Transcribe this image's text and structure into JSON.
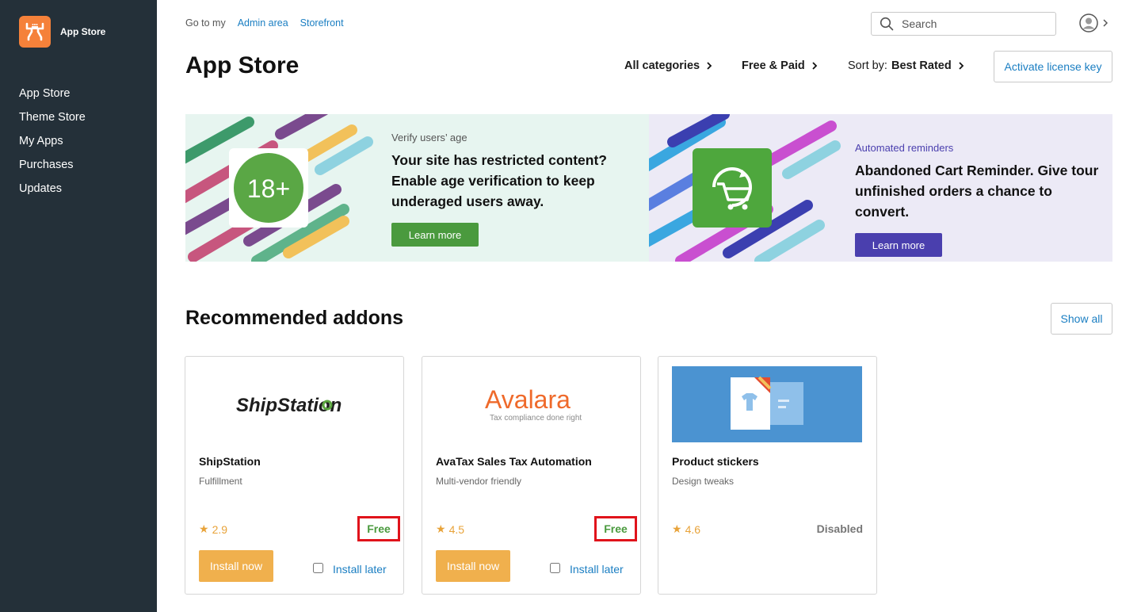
{
  "app": {
    "brand_name": "App Store"
  },
  "sidebar": {
    "items": [
      {
        "label": "App Store"
      },
      {
        "label": "Theme Store"
      },
      {
        "label": "My Apps"
      },
      {
        "label": "Purchases"
      },
      {
        "label": "Updates"
      }
    ]
  },
  "topbar": {
    "goto_text": "Go to my",
    "links": [
      "Admin area",
      "Storefront"
    ],
    "search_placeholder": "Search"
  },
  "header": {
    "title": "App Store",
    "categories_filter": "All categories",
    "price_filter": "Free & Paid",
    "sort_label": "Sort by:",
    "sort_value": "Best Rated",
    "activate_label": "Activate license key"
  },
  "banners": [
    {
      "eyebrow": "Verify users’ age",
      "headline": "Your site has restricted content? Enable age verification to keep underaged users away.",
      "badge_text": "18+",
      "button": "Learn more",
      "accent": "#4a9a3e"
    },
    {
      "eyebrow": "Automated reminders",
      "headline": "Abandoned Cart Reminder. Give tour unfinished orders a chance to convert.",
      "button": "Learn more",
      "accent": "#4a3fae"
    }
  ],
  "recommended": {
    "title": "Recommended addons",
    "show_all": "Show all",
    "cards": [
      {
        "logo_text": "ShipStation",
        "name": "ShipStation",
        "category": "Fulfillment",
        "rating": "2.9",
        "price": "Free",
        "install": "Install now",
        "install_later": "Install later"
      },
      {
        "logo_text": "Avalara",
        "logo_tagline": "Tax compliance done right",
        "name": "AvaTax Sales Tax Automation",
        "category": "Multi-vendor friendly",
        "rating": "4.5",
        "price": "Free",
        "install": "Install now",
        "install_later": "Install later"
      },
      {
        "name": "Product stickers",
        "category": "Design tweaks",
        "rating": "4.6",
        "status": "Disabled"
      }
    ]
  },
  "colors": {
    "sidebar_bg": "#243039",
    "brand_orange": "#f5813a",
    "link_blue": "#1a7ec2",
    "install_orange": "#f0b04d",
    "free_green": "#4a9a3e",
    "highlight_red": "#e0131b"
  }
}
